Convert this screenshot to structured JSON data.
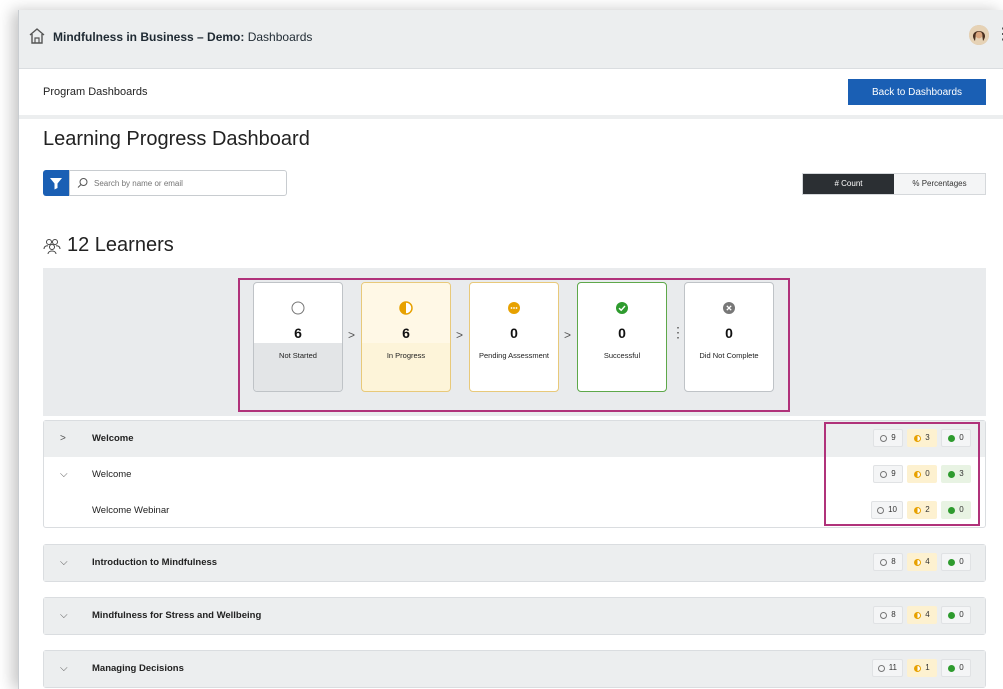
{
  "app": {
    "title_bold": "Mindfulness in Business – Demo:",
    "title_rest": " Dashboards"
  },
  "subbar": {
    "crumb": "Program Dashboards",
    "back_label": "Back to Dashboards"
  },
  "page": {
    "title": "Learning Progress Dashboard"
  },
  "search": {
    "placeholder": "Search by name or email"
  },
  "toggle": {
    "count_label": "# Count",
    "percent_label": "% Percentages"
  },
  "learners": {
    "label": "12 Learners"
  },
  "funnel": [
    {
      "value": "6",
      "label": "Not Started"
    },
    {
      "value": "6",
      "label": "In Progress"
    },
    {
      "value": "0",
      "label": "Pending Assessment"
    },
    {
      "value": "0",
      "label": "Successful"
    },
    {
      "value": "0",
      "label": "Did Not Complete"
    }
  ],
  "modules": [
    {
      "name": "Welcome",
      "expanded": true,
      "counts": [
        "9",
        "3",
        "0"
      ],
      "children": [
        {
          "name": "Welcome",
          "counts": [
            "9",
            "0",
            "3"
          ]
        },
        {
          "name": "Welcome Webinar",
          "counts": [
            "10",
            "2",
            "0"
          ]
        }
      ]
    },
    {
      "name": "Introduction to Mindfulness",
      "counts": [
        "8",
        "4",
        "0"
      ]
    },
    {
      "name": "Mindfulness for Stress and Wellbeing",
      "counts": [
        "8",
        "4",
        "0"
      ]
    },
    {
      "name": "Managing Decisions",
      "counts": [
        "11",
        "1",
        "0"
      ]
    }
  ],
  "colors": {
    "primary": "#1a5fb4",
    "highlight": "#b0327a",
    "in_progress": "#e7a100",
    "success": "#2e9b2e"
  }
}
